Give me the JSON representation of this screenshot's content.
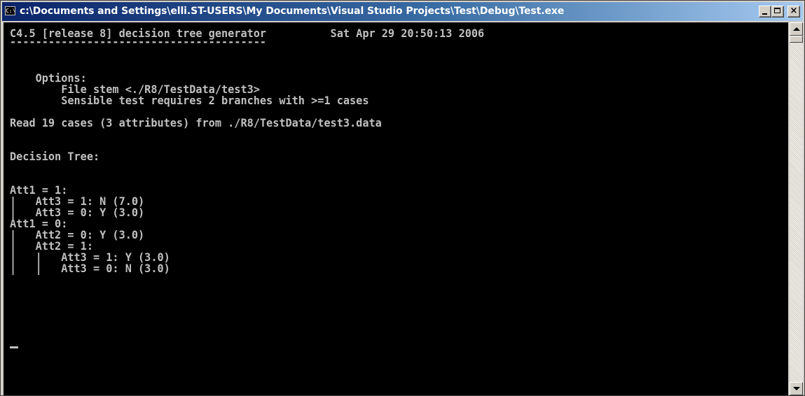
{
  "window": {
    "title": "c:\\Documents and Settings\\elli.ST-USERS\\My Documents\\Visual Studio Projects\\Test\\Debug\\Test.exe",
    "icon_text": "C:\\",
    "buttons": {
      "minimize": "minimize",
      "maximize": "maximize",
      "close": "×"
    }
  },
  "console": {
    "lines": [
      "C4.5 [release 8] decision tree generator          Sat Apr 29 20:50:13 2006",
      "----------------------------------------",
      "",
      "    Options:",
      "        File stem <./R8/TestData/test3>",
      "        Sensible test requires 2 branches with >=1 cases",
      "",
      "Read 19 cases (3 attributes) from ./R8/TestData/test3.data",
      "",
      "Decision Tree:",
      "",
      "Att1 = 1:",
      "|   Att3 = 1: N (7.0)",
      "|   Att3 = 0: Y (3.0)",
      "Att1 = 0:",
      "|   Att2 = 0: Y (3.0)",
      "|   Att2 = 1:",
      "|   |   Att3 = 1: Y (3.0)",
      "|   |   Att3 = 0: N (3.0)"
    ],
    "colors": {
      "background": "#000000",
      "text": "#c0c0c0"
    }
  },
  "scrollbar": {
    "up_icon": "scroll-up-arrow",
    "down_icon": "scroll-down-arrow"
  }
}
